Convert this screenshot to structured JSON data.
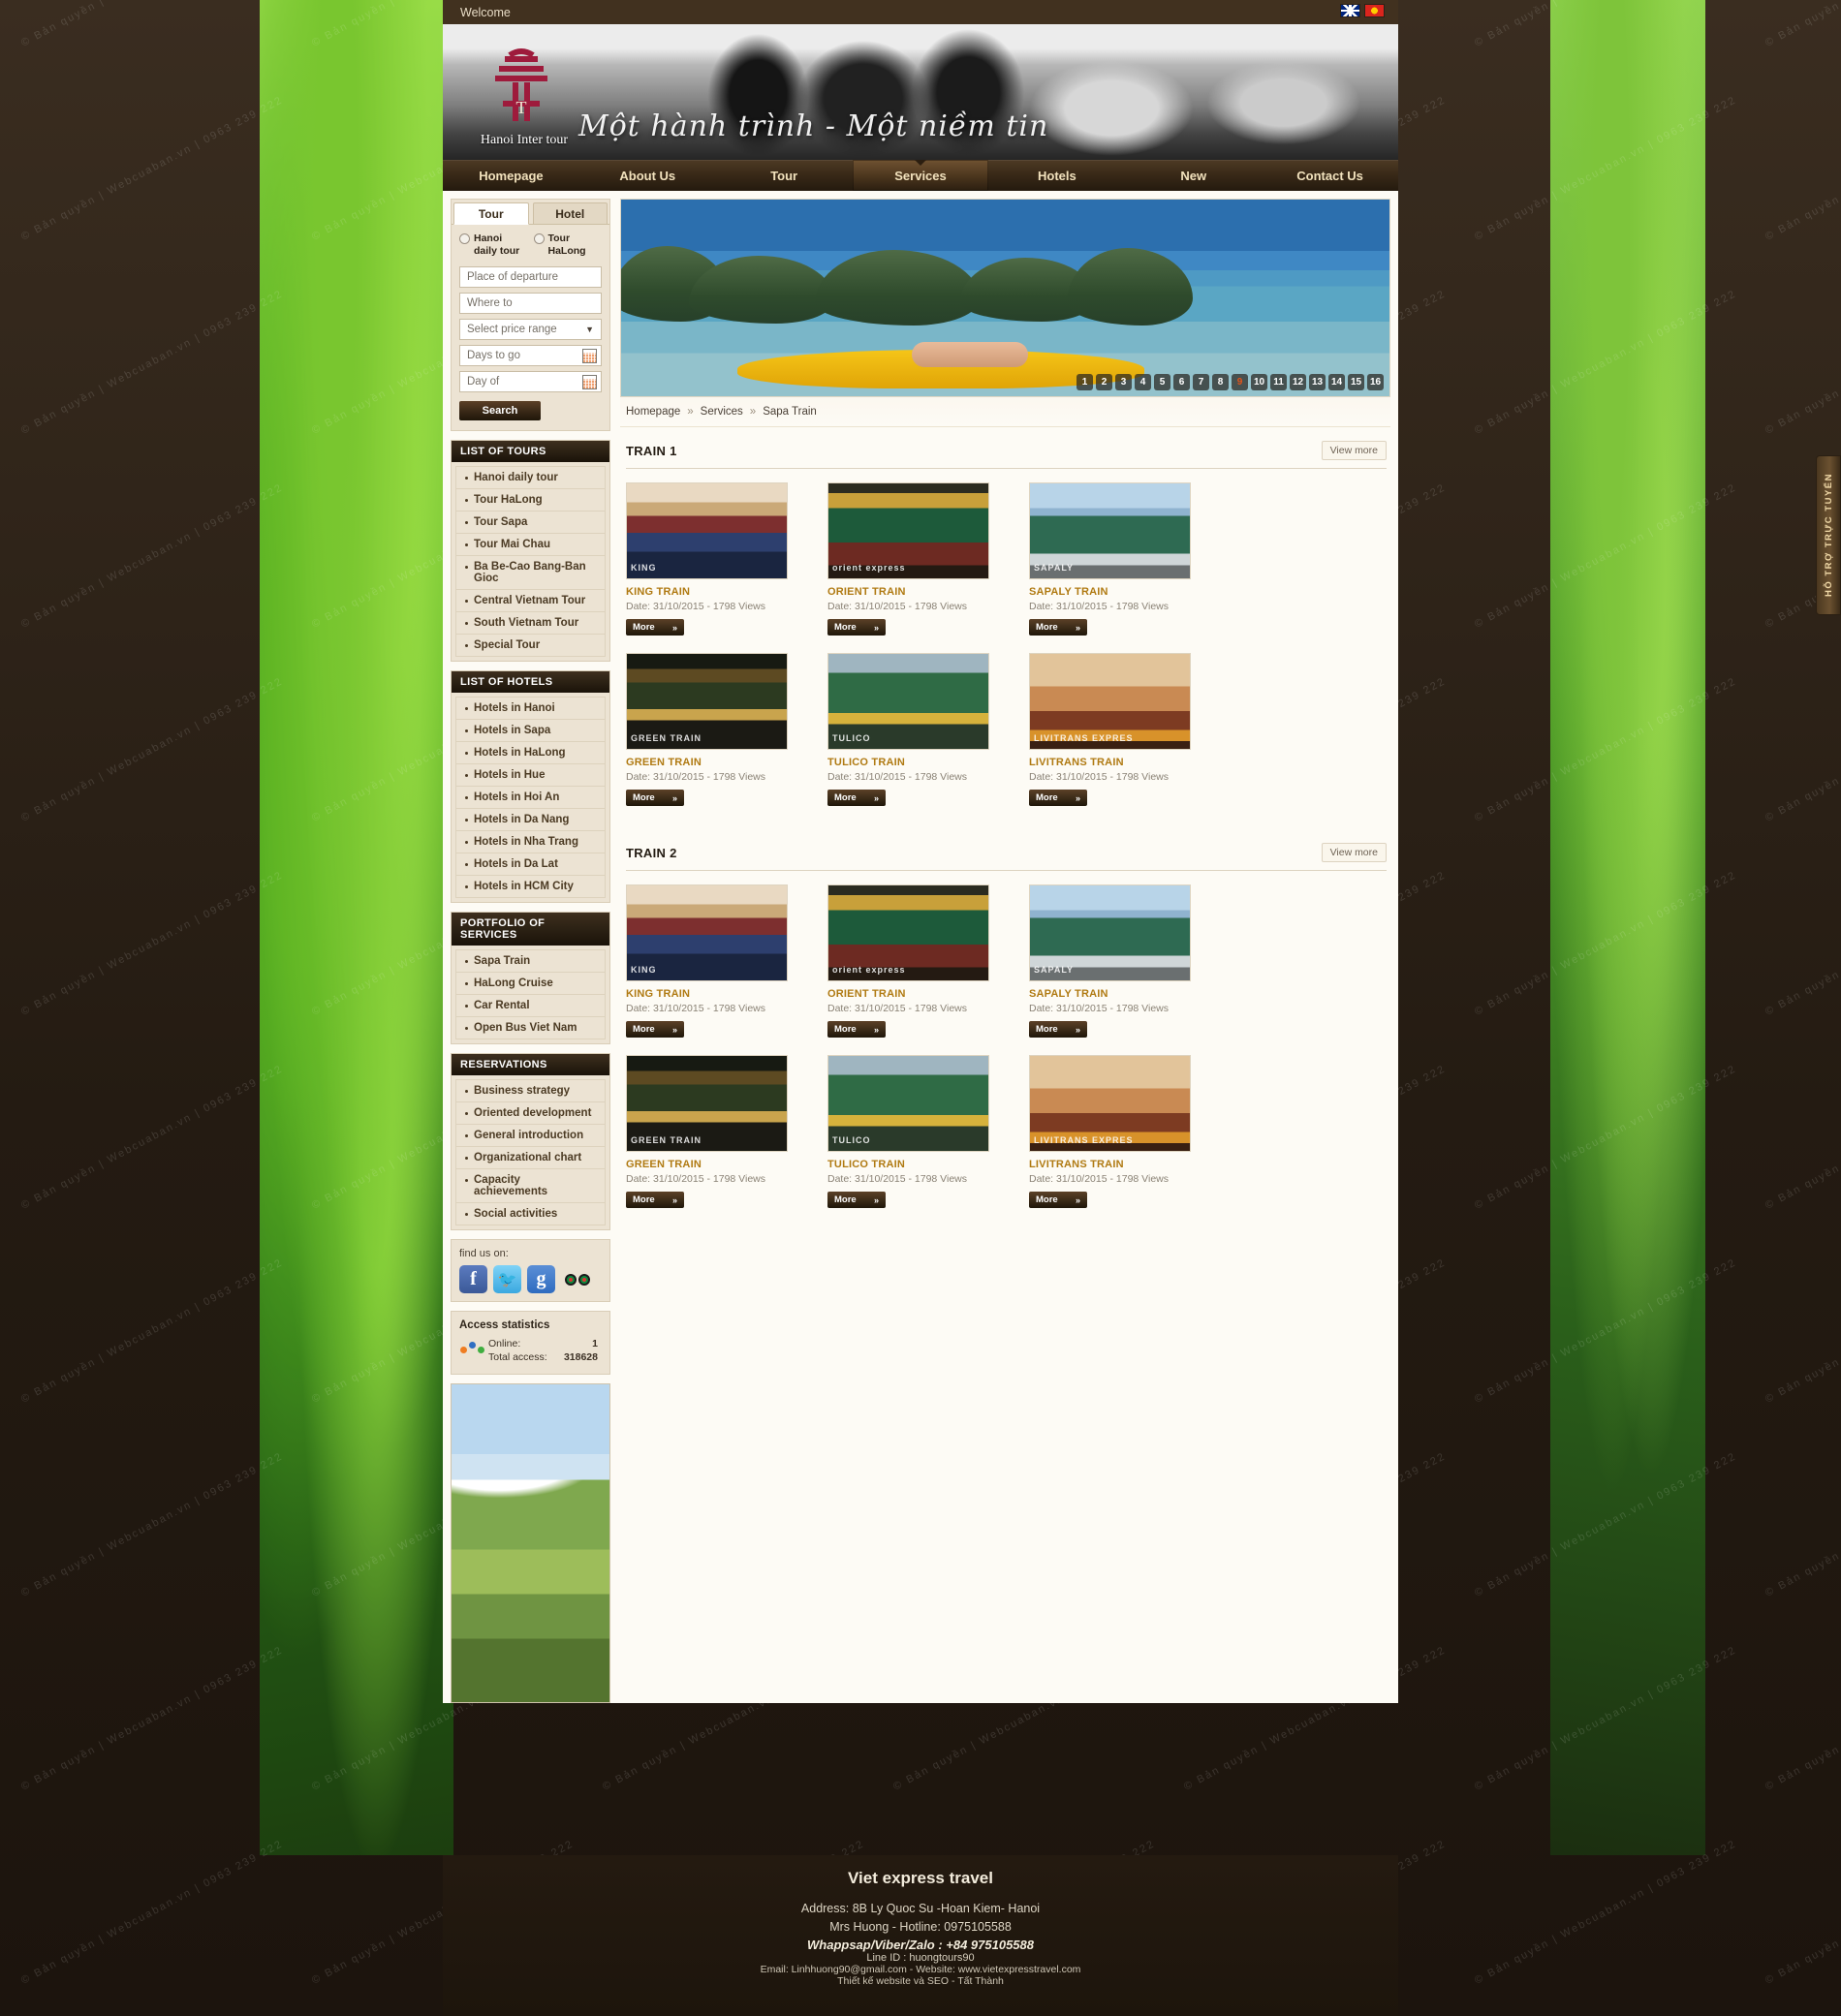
{
  "topbar": {
    "welcome": "Welcome",
    "flags": [
      "uk-flag",
      "vietnam-flag"
    ]
  },
  "brand": {
    "logo_text": "Hanoi Inter tour",
    "slogan": "Một hành trình - Một niềm tin"
  },
  "nav": {
    "items": [
      {
        "label": "Homepage",
        "active": false
      },
      {
        "label": "About Us",
        "active": false
      },
      {
        "label": "Tour",
        "active": false
      },
      {
        "label": "Services",
        "active": true
      },
      {
        "label": "Hotels",
        "active": false
      },
      {
        "label": "New",
        "active": false
      },
      {
        "label": "Contact Us",
        "active": false
      }
    ]
  },
  "searchbox": {
    "tabs": [
      {
        "label": "Tour",
        "active": true
      },
      {
        "label": "Hotel",
        "active": false
      }
    ],
    "radios": [
      {
        "label": "Hanoi daily tour"
      },
      {
        "label": "Tour HaLong"
      }
    ],
    "place_of_departure": "Place of departure",
    "where_to": "Where to",
    "price_range": "Select price range",
    "days_to_go": "Days to go",
    "day_of": "Day of",
    "search_label": "Search"
  },
  "sidebar": {
    "tours": {
      "title": "LIST OF TOURS",
      "items": [
        "Hanoi daily tour",
        "Tour HaLong",
        "Tour Sapa",
        "Tour Mai Chau",
        "Ba Be-Cao Bang-Ban Gioc",
        "Central Vietnam Tour",
        "South Vietnam Tour",
        "Special Tour"
      ]
    },
    "hotels": {
      "title": "LIST OF HOTELS",
      "items": [
        "Hotels in Hanoi",
        "Hotels in Sapa",
        "Hotels in HaLong",
        "Hotels in Hue",
        "Hotels in Hoi An",
        "Hotels in Da Nang",
        "Hotels in Nha Trang",
        "Hotels in Da Lat",
        "Hotels in HCM City"
      ]
    },
    "services": {
      "title": "PORTFOLIO OF SERVICES",
      "items": [
        "Sapa Train",
        "HaLong Cruise",
        "Car Rental",
        "Open Bus Viet Nam"
      ]
    },
    "reservations": {
      "title": "RESERVATIONS",
      "items": [
        "Business strategy",
        "Oriented development",
        "General introduction",
        "Organizational chart",
        "Capacity achievements",
        "Social activities"
      ]
    },
    "social": {
      "label": "find us on:",
      "networks": [
        {
          "name": "facebook-icon",
          "glyph": "f"
        },
        {
          "name": "twitter-icon",
          "glyph": "t"
        },
        {
          "name": "google-plus-icon",
          "glyph": "g"
        },
        {
          "name": "tripadvisor-icon",
          "glyph": "tripadvisor"
        }
      ]
    },
    "stats": {
      "title": "Access statistics",
      "online_label": "Online:",
      "online_value": "1",
      "total_label": "Total access:",
      "total_value": "318628"
    }
  },
  "slider": {
    "pages": [
      "1",
      "2",
      "3",
      "4",
      "5",
      "6",
      "7",
      "8",
      "9",
      "10",
      "11",
      "12",
      "13",
      "14",
      "15",
      "16"
    ],
    "current": "9"
  },
  "breadcrumb": {
    "items": [
      "Homepage",
      "Services",
      "Sapa Train"
    ],
    "separator": "»"
  },
  "sections": [
    {
      "title": "TRAIN 1",
      "view_more": "View more",
      "cards": [
        {
          "title": "KING TRAIN",
          "meta": "Date: 31/10/2015 - 1798 Views",
          "more": "More",
          "art": "t-king",
          "caption": "KING"
        },
        {
          "title": "ORIENT TRAIN",
          "meta": "Date: 31/10/2015 - 1798 Views",
          "more": "More",
          "art": "t-orient",
          "caption": "orient express"
        },
        {
          "title": "SAPALY TRAIN",
          "meta": "Date: 31/10/2015 - 1798 Views",
          "more": "More",
          "art": "t-sapaly",
          "caption": "SAPALY"
        },
        {
          "title": "GREEN TRAIN",
          "meta": "Date: 31/10/2015 - 1798 Views",
          "more": "More",
          "art": "t-green",
          "caption": "GREEN TRAIN"
        },
        {
          "title": "TULICO TRAIN",
          "meta": "Date: 31/10/2015 - 1798 Views",
          "more": "More",
          "art": "t-tulico",
          "caption": "TULICO"
        },
        {
          "title": "LIVITRANS TRAIN",
          "meta": "Date: 31/10/2015 - 1798 Views",
          "more": "More",
          "art": "t-livi",
          "caption": "LIVITRANS EXPRES"
        }
      ]
    },
    {
      "title": "TRAIN 2",
      "view_more": "View more",
      "cards": [
        {
          "title": "KING TRAIN",
          "meta": "Date: 31/10/2015 - 1798 Views",
          "more": "More",
          "art": "t-king",
          "caption": "KING"
        },
        {
          "title": "ORIENT TRAIN",
          "meta": "Date: 31/10/2015 - 1798 Views",
          "more": "More",
          "art": "t-orient",
          "caption": "orient express"
        },
        {
          "title": "SAPALY TRAIN",
          "meta": "Date: 31/10/2015 - 1798 Views",
          "more": "More",
          "art": "t-sapaly",
          "caption": "SAPALY"
        },
        {
          "title": "GREEN TRAIN",
          "meta": "Date: 31/10/2015 - 1798 Views",
          "more": "More",
          "art": "t-green",
          "caption": "GREEN TRAIN"
        },
        {
          "title": "TULICO TRAIN",
          "meta": "Date: 31/10/2015 - 1798 Views",
          "more": "More",
          "art": "t-tulico",
          "caption": "TULICO"
        },
        {
          "title": "LIVITRANS TRAIN",
          "meta": "Date: 31/10/2015 - 1798 Views",
          "more": "More",
          "art": "t-livi",
          "caption": "LIVITRANS EXPRES"
        }
      ]
    }
  ],
  "support_tab": {
    "label": "HỖ TRỢ TRỰC TUYẾN"
  },
  "footer": {
    "name": "Viet express travel",
    "address": "Address: 8B Ly Quoc Su -Hoan Kiem- Hanoi",
    "hotline": "Mrs Huong -  Hotline: 0975105588",
    "whatsapp": "Whappsap/Viber/Zalo : +84 975105588",
    "line": "Line ID : huongtours90",
    "email_web": "Email: Linhhuong90@gmail.com  - Website: www.vietexpresstravel.com",
    "credit": "Thiết kế website  và  SEO -  Tất Thành"
  },
  "watermark": {
    "text": "© Bản quyền | Webcuaban.vn | 0963 239 222"
  },
  "colors": {
    "accent_gold": "#b07a12",
    "nav_bg": "#3a2a18",
    "panel_bg": "#ece3d3",
    "page_bg": "#fdfbf5"
  }
}
